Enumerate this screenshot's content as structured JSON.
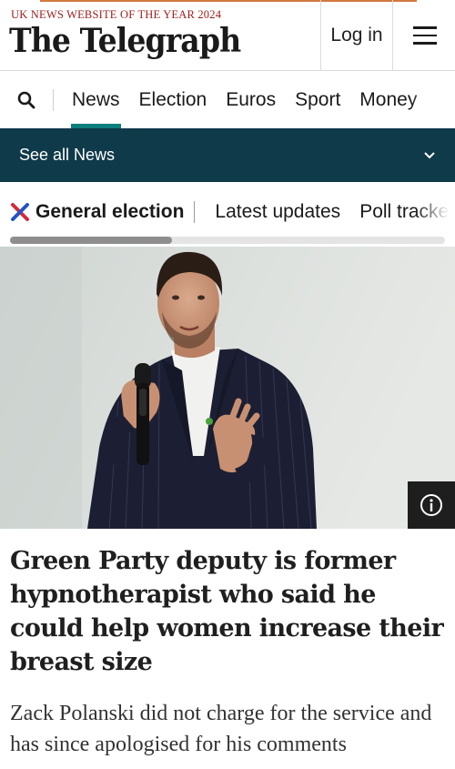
{
  "masthead": {
    "award": "UK NEWS WEBSITE OF THE YEAR 2024",
    "logo": "The Telegraph",
    "login_label": "Log in",
    "menu_icon": "hamburger-icon"
  },
  "primary_nav": {
    "search_icon": "search-icon",
    "items": [
      "News",
      "Election",
      "Euros",
      "Sport",
      "Money"
    ],
    "active": "News"
  },
  "section_bar": {
    "label": "See all News",
    "icon": "chevron-down-icon"
  },
  "secondary_nav": {
    "brand_icon": "election-cross-icon",
    "items": [
      "General election",
      "Latest updates",
      "Poll tracker"
    ]
  },
  "hero": {
    "info_icon": "info-icon"
  },
  "article": {
    "headline": "Green Party deputy is former hypnotherapist who said he could help women increase their breast size",
    "standfirst": "Zack Polanski did not charge for the service and has since apologised for his comments"
  },
  "colors": {
    "award_red": "#9e1b1b",
    "active_tab": "#0d7e7e",
    "section_bar": "#0f3a4a",
    "cross_blue": "#2255c4",
    "cross_red": "#d42a3a"
  }
}
